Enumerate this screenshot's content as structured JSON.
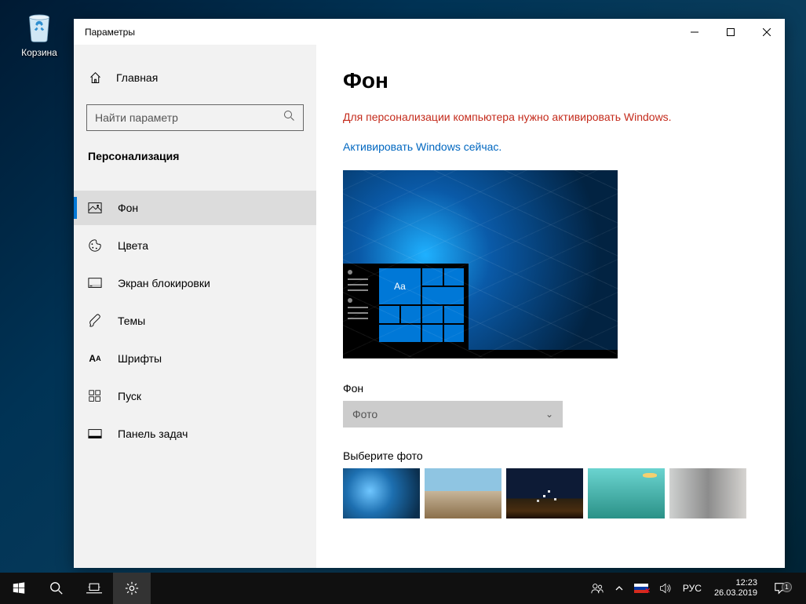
{
  "desktop": {
    "recycle_bin": "Корзина"
  },
  "window": {
    "title": "Параметры",
    "home": "Главная",
    "search_placeholder": "Найти параметр",
    "section": "Персонализация",
    "nav": {
      "background": "Фон",
      "colors": "Цвета",
      "lockscreen": "Экран блокировки",
      "themes": "Темы",
      "fonts": "Шрифты",
      "start": "Пуск",
      "taskbar": "Панель задач"
    }
  },
  "content": {
    "title": "Фон",
    "warning": "Для персонализации компьютера нужно активировать Windows.",
    "activate_link": "Активировать Windows сейчас.",
    "preview_tile_text": "Aa",
    "bg_label": "Фон",
    "bg_dropdown_value": "Фото",
    "choose_label": "Выберите фото"
  },
  "taskbar": {
    "lang": "РУС",
    "time": "12:23",
    "date": "26.03.2019",
    "badge": "1"
  }
}
